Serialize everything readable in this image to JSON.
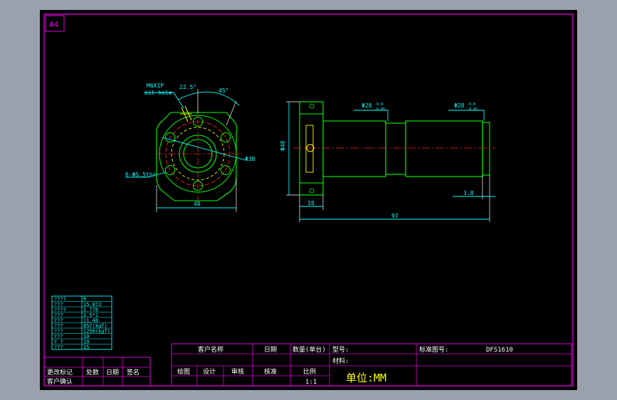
{
  "sheet": {
    "size_label": "A4"
  },
  "flange_view": {
    "thread_note_line1": "M6X1P",
    "thread_note_line2": "oil hole",
    "angle_small": "22.5°",
    "angle_large": "45°",
    "pcd_label": "Φ38",
    "bolt_holes_label": "6-Φ5.5thr",
    "width_label": "40"
  },
  "side_view": {
    "flange_diameter_label": "Φ48",
    "shaft_dia_left": "Φ28",
    "shaft_dia_right": "Φ28",
    "tolerance_upper": "-0.0",
    "tolerance_lower": "-0.05",
    "flange_width_label": "10",
    "end_length_label": "3.8",
    "total_length_label": "97"
  },
  "spec_table": {
    "rows": [
      [
        "????",
        "R"
      ],
      [
        "???",
        "15.872"
      ],
      [
        "????",
        "2.778"
      ],
      [
        "???",
        "2.5*1"
      ],
      [
        "Y??",
        "11.48"
      ],
      [
        "???",
        "857(kgf)"
      ],
      [
        "???",
        "1256(kgf)"
      ],
      [
        "Y??",
        "10"
      ],
      [
        "Y  ?",
        "10"
      ],
      [
        "???",
        "15"
      ]
    ]
  },
  "revision_block": {
    "change_label": "更改标记",
    "quantity_label": "处数",
    "date_label": "日期",
    "sign_label": "签名",
    "customer_confirm_label": "客户确认"
  },
  "title_block": {
    "customer_name_label": "客户名称",
    "date_label": "日期",
    "quantity_label": "数量(单台)",
    "model_label": "型号:",
    "std_drawing_label": "标准图号:",
    "std_drawing_value": "DFS1610",
    "material_label": "材料:",
    "draw_label": "绘图",
    "design_label": "设计",
    "review_label": "审核",
    "approve_label": "核准",
    "scale_label": "比例",
    "scale_value": "1:1",
    "unit_label": "单位:MM"
  }
}
